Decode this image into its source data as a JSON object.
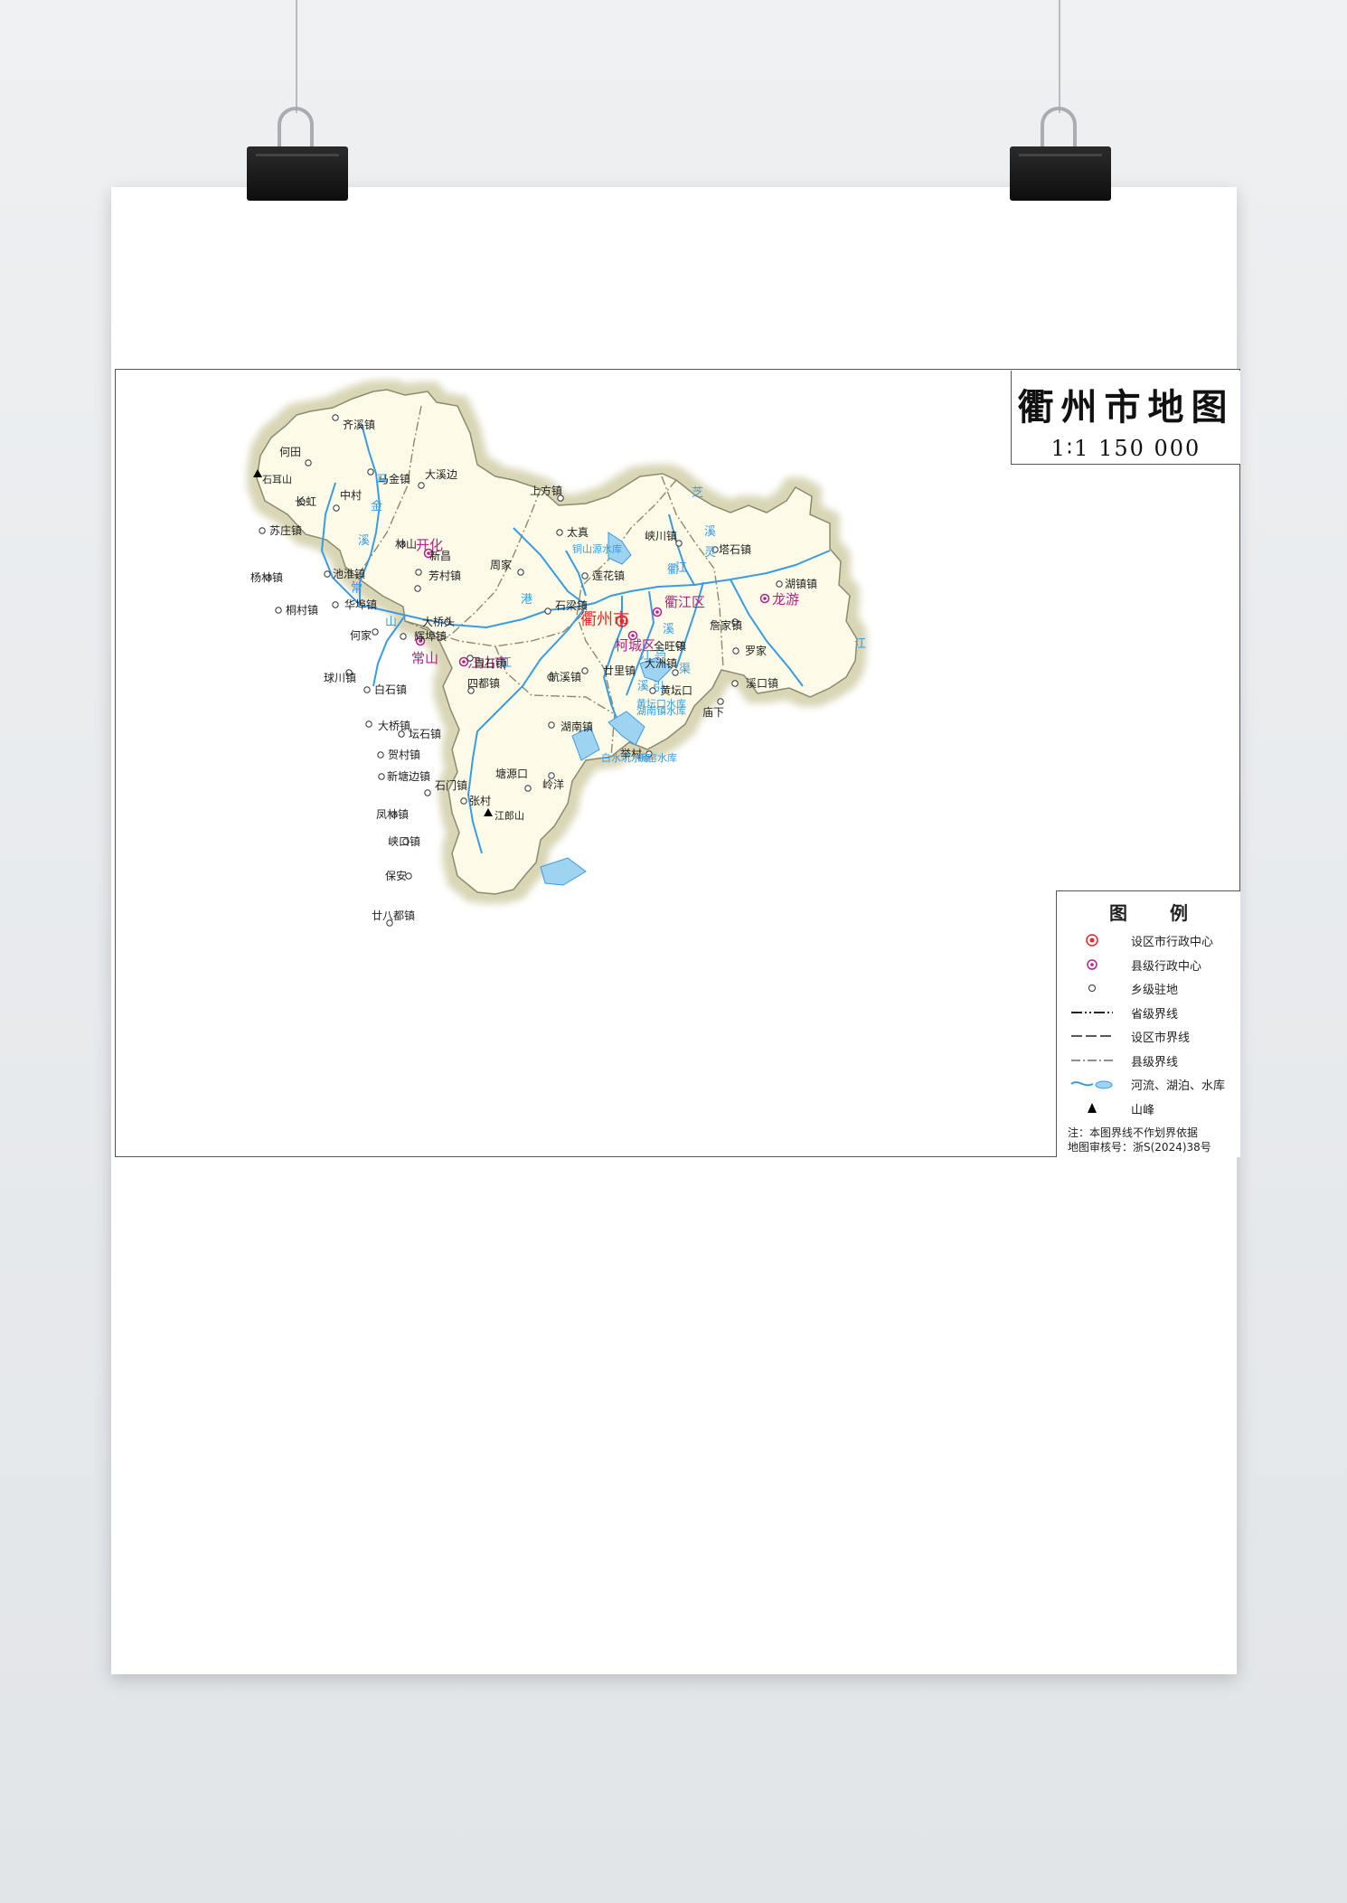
{
  "map": {
    "title": "衢州市地图",
    "scale": "1∶1 150 000",
    "cities": [
      {
        "name": "衢州市",
        "type": "prefecture"
      },
      {
        "name": "衢江区",
        "type": "county"
      },
      {
        "name": "柯城区",
        "type": "county"
      },
      {
        "name": "龙游",
        "type": "county"
      },
      {
        "name": "常山",
        "type": "county"
      },
      {
        "name": "开化",
        "type": "county"
      },
      {
        "name": "江山市",
        "type": "county"
      }
    ],
    "towns": [
      "齐溪镇",
      "何田",
      "马金镇",
      "大溪边",
      "长虹",
      "中村",
      "苏庄镇",
      "林山",
      "杨林镇",
      "池淮镇",
      "新昌",
      "芳村镇",
      "桐村镇",
      "华埠镇",
      "大桥头",
      "辉埠镇",
      "何家",
      "青石镇",
      "球川镇",
      "白石镇",
      "四都镇",
      "廿里镇",
      "大桥镇",
      "坛石镇",
      "贺村镇",
      "新塘边镇",
      "石门镇",
      "张村",
      "凤林镇",
      "峡口镇",
      "保安",
      "廿八都镇",
      "上方镇",
      "太真",
      "峡川镇",
      "周家",
      "莲花镇",
      "石梁镇",
      "全旺镇",
      "大洲镇",
      "黄坛口",
      "湖南镇",
      "举村",
      "岭洋",
      "塘源口",
      "塔石镇",
      "湖镇镇",
      "詹家镇",
      "罗家",
      "溪口镇",
      "庙下",
      "航溪镇"
    ],
    "waters": [
      "马",
      "金",
      "溪",
      "常",
      "山",
      "港",
      "江",
      "衢",
      "江",
      "芝",
      "溪",
      "灵",
      "溪",
      "乌",
      "溪",
      "江",
      "江",
      "渠",
      "引",
      "铜山源水库",
      "黄坛口水库",
      "湖南镇水库",
      "碗窑水库",
      "白水坑水库"
    ],
    "peaks": [
      "石耳山",
      "江郎山"
    ]
  },
  "legend": {
    "title": "图 例",
    "items": [
      {
        "label": "设区市行政中心",
        "icon": "prefecture-center-icon"
      },
      {
        "label": "县级行政中心",
        "icon": "county-center-icon"
      },
      {
        "label": "乡级驻地",
        "icon": "township-icon"
      },
      {
        "label": "省级界线",
        "icon": "provincial-boundary-icon"
      },
      {
        "label": "设区市界线",
        "icon": "city-boundary-icon"
      },
      {
        "label": "县级界线",
        "icon": "county-boundary-icon"
      },
      {
        "label": "河流、湖泊、水库",
        "icon": "water-icon"
      },
      {
        "label": "山峰",
        "icon": "peak-icon"
      }
    ],
    "note_line1": "注：本图界线不作划界依据",
    "note_line2": "地图审核号：浙S(2024)38号"
  },
  "colors": {
    "land": "#fdfbe8",
    "border_glow": "#d9d6b6",
    "river": "#3a9be0",
    "prefecture": "#e8272a",
    "county": "#b0228a"
  }
}
